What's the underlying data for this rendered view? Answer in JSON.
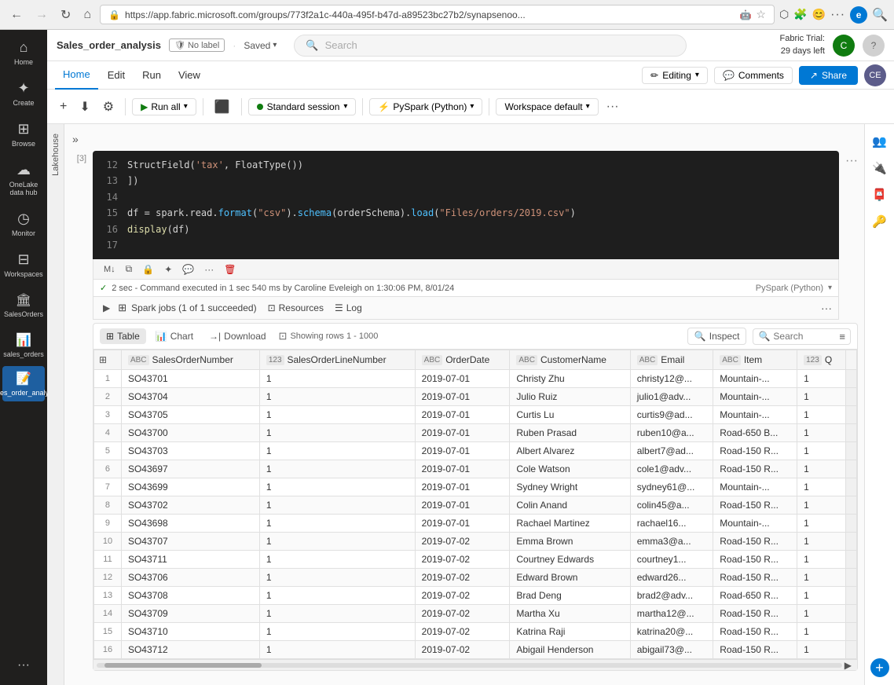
{
  "browser": {
    "url": "https://app.fabric.microsoft.com/groups/773f2a1c-440a-495f-b47d-a89523bc27b2/synapsenoo...",
    "back_btn": "←",
    "forward_btn": "→",
    "refresh_btn": "↻",
    "home_btn": "⌂"
  },
  "fabric_trial": {
    "label": "Fabric Trial:",
    "days": "29 days left"
  },
  "topbar": {
    "file_name": "Sales_order_analysis",
    "no_label": "No label",
    "saved": "Saved",
    "search_placeholder": "Search"
  },
  "menu": {
    "items": [
      "Home",
      "Edit",
      "Run",
      "View"
    ],
    "active": "Home",
    "editing_label": "Editing",
    "comments_label": "Comments",
    "share_label": "Share"
  },
  "toolbar": {
    "run_all": "Run all",
    "session_label": "Standard session",
    "pyspark_label": "PySpark (Python)",
    "workspace_label": "Workspace default"
  },
  "lakehouse": {
    "label": "Lakehouse"
  },
  "code_cell": {
    "line_numbers": [
      12,
      13,
      14,
      15,
      16,
      17
    ],
    "lines": [
      "    StructField('tax', FloatType())",
      "])",
      "",
      "df = spark.read.format(\"csv\").schema(orderSchema).load(\"Files/orders/2019.csv\")",
      "display(df)",
      ""
    ]
  },
  "cell_status": {
    "check": "✓",
    "message": "2 sec - Command executed in 1 sec 540 ms by Caroline Eveleigh on 1:30:06 PM, 8/01/24",
    "engine": "PySpark (Python)"
  },
  "spark_jobs": {
    "label": "Spark jobs (1 of 1 succeeded)",
    "tab_resources": "Resources",
    "tab_log": "Log"
  },
  "output_toolbar": {
    "tab_table": "Table",
    "tab_chart": "Chart",
    "tab_download": "Download",
    "tab_search": "Search",
    "showing_rows": "Showing rows 1 - 1000",
    "inspect_label": "Inspect",
    "search_placeholder": "Search"
  },
  "table_headers": [
    {
      "id": "rownum",
      "label": "",
      "type": ""
    },
    {
      "id": "rowicon",
      "label": "",
      "type": ""
    },
    {
      "id": "salesordernumber",
      "label": "SalesOrderNumber",
      "type": "ABC"
    },
    {
      "id": "salesorderlinenumber",
      "label": "SalesOrderLineNumber",
      "type": "123"
    },
    {
      "id": "orderdate",
      "label": "OrderDate",
      "type": "ABC"
    },
    {
      "id": "customername",
      "label": "CustomerName",
      "type": "ABC"
    },
    {
      "id": "email",
      "label": "Email",
      "type": "ABC"
    },
    {
      "id": "item",
      "label": "Item",
      "type": "ABC"
    },
    {
      "id": "q",
      "label": "Q",
      "type": "123"
    }
  ],
  "table_rows": [
    {
      "num": 1,
      "order": "SO43701",
      "line": 1,
      "date": "2019-07-01",
      "customer": "Christy Zhu",
      "email": "christy12@...",
      "item": "Mountain-...",
      "q": 1
    },
    {
      "num": 2,
      "order": "SO43704",
      "line": 1,
      "date": "2019-07-01",
      "customer": "Julio Ruiz",
      "email": "julio1@adv...",
      "item": "Mountain-...",
      "q": 1
    },
    {
      "num": 3,
      "order": "SO43705",
      "line": 1,
      "date": "2019-07-01",
      "customer": "Curtis Lu",
      "email": "curtis9@ad...",
      "item": "Mountain-...",
      "q": 1
    },
    {
      "num": 4,
      "order": "SO43700",
      "line": 1,
      "date": "2019-07-01",
      "customer": "Ruben Prasad",
      "email": "ruben10@a...",
      "item": "Road-650 B...",
      "q": 1
    },
    {
      "num": 5,
      "order": "SO43703",
      "line": 1,
      "date": "2019-07-01",
      "customer": "Albert Alvarez",
      "email": "albert7@ad...",
      "item": "Road-150 R...",
      "q": 1
    },
    {
      "num": 6,
      "order": "SO43697",
      "line": 1,
      "date": "2019-07-01",
      "customer": "Cole Watson",
      "email": "cole1@adv...",
      "item": "Road-150 R...",
      "q": 1
    },
    {
      "num": 7,
      "order": "SO43699",
      "line": 1,
      "date": "2019-07-01",
      "customer": "Sydney Wright",
      "email": "sydney61@...",
      "item": "Mountain-...",
      "q": 1
    },
    {
      "num": 8,
      "order": "SO43702",
      "line": 1,
      "date": "2019-07-01",
      "customer": "Colin Anand",
      "email": "colin45@a...",
      "item": "Road-150 R...",
      "q": 1
    },
    {
      "num": 9,
      "order": "SO43698",
      "line": 1,
      "date": "2019-07-01",
      "customer": "Rachael Martinez",
      "email": "rachael16...",
      "item": "Mountain-...",
      "q": 1
    },
    {
      "num": 10,
      "order": "SO43707",
      "line": 1,
      "date": "2019-07-02",
      "customer": "Emma Brown",
      "email": "emma3@a...",
      "item": "Road-150 R...",
      "q": 1
    },
    {
      "num": 11,
      "order": "SO43711",
      "line": 1,
      "date": "2019-07-02",
      "customer": "Courtney Edwards",
      "email": "courtney1...",
      "item": "Road-150 R...",
      "q": 1
    },
    {
      "num": 12,
      "order": "SO43706",
      "line": 1,
      "date": "2019-07-02",
      "customer": "Edward Brown",
      "email": "edward26...",
      "item": "Road-150 R...",
      "q": 1
    },
    {
      "num": 13,
      "order": "SO43708",
      "line": 1,
      "date": "2019-07-02",
      "customer": "Brad Deng",
      "email": "brad2@adv...",
      "item": "Road-650 R...",
      "q": 1
    },
    {
      "num": 14,
      "order": "SO43709",
      "line": 1,
      "date": "2019-07-02",
      "customer": "Martha Xu",
      "email": "martha12@...",
      "item": "Road-150 R...",
      "q": 1
    },
    {
      "num": 15,
      "order": "SO43710",
      "line": 1,
      "date": "2019-07-02",
      "customer": "Katrina Raji",
      "email": "katrina20@...",
      "item": "Road-150 R...",
      "q": 1
    },
    {
      "num": 16,
      "order": "SO43712",
      "line": 1,
      "date": "2019-07-02",
      "customer": "Abigail Henderson",
      "email": "abigail73@...",
      "item": "Road-150 R...",
      "q": 1
    }
  ],
  "sidebar_left": {
    "items": [
      {
        "id": "home",
        "icon": "⌂",
        "label": "Home"
      },
      {
        "id": "create",
        "icon": "+",
        "label": "Create"
      },
      {
        "id": "browse",
        "icon": "⊞",
        "label": "Browse"
      },
      {
        "id": "onelake",
        "icon": "☁",
        "label": "OneLake data hub"
      },
      {
        "id": "monitor",
        "icon": "◷",
        "label": "Monitor"
      },
      {
        "id": "workspaces",
        "icon": "⊟",
        "label": "Workspaces"
      },
      {
        "id": "salesorders",
        "icon": "📋",
        "label": "SalesOrders"
      },
      {
        "id": "sales_orders",
        "icon": "📄",
        "label": "sales_orders"
      },
      {
        "id": "sales_order_analysis",
        "icon": "📝",
        "label": "Sales_order_analysis"
      }
    ]
  },
  "right_panel": {
    "icons": [
      "👥",
      "🔌",
      "📮",
      "🔑",
      "+"
    ]
  },
  "colors": {
    "accent": "#0078d4",
    "green": "#107c10",
    "sidebar_bg": "#201f1e",
    "active_item_bg": "#2e5ea8"
  }
}
